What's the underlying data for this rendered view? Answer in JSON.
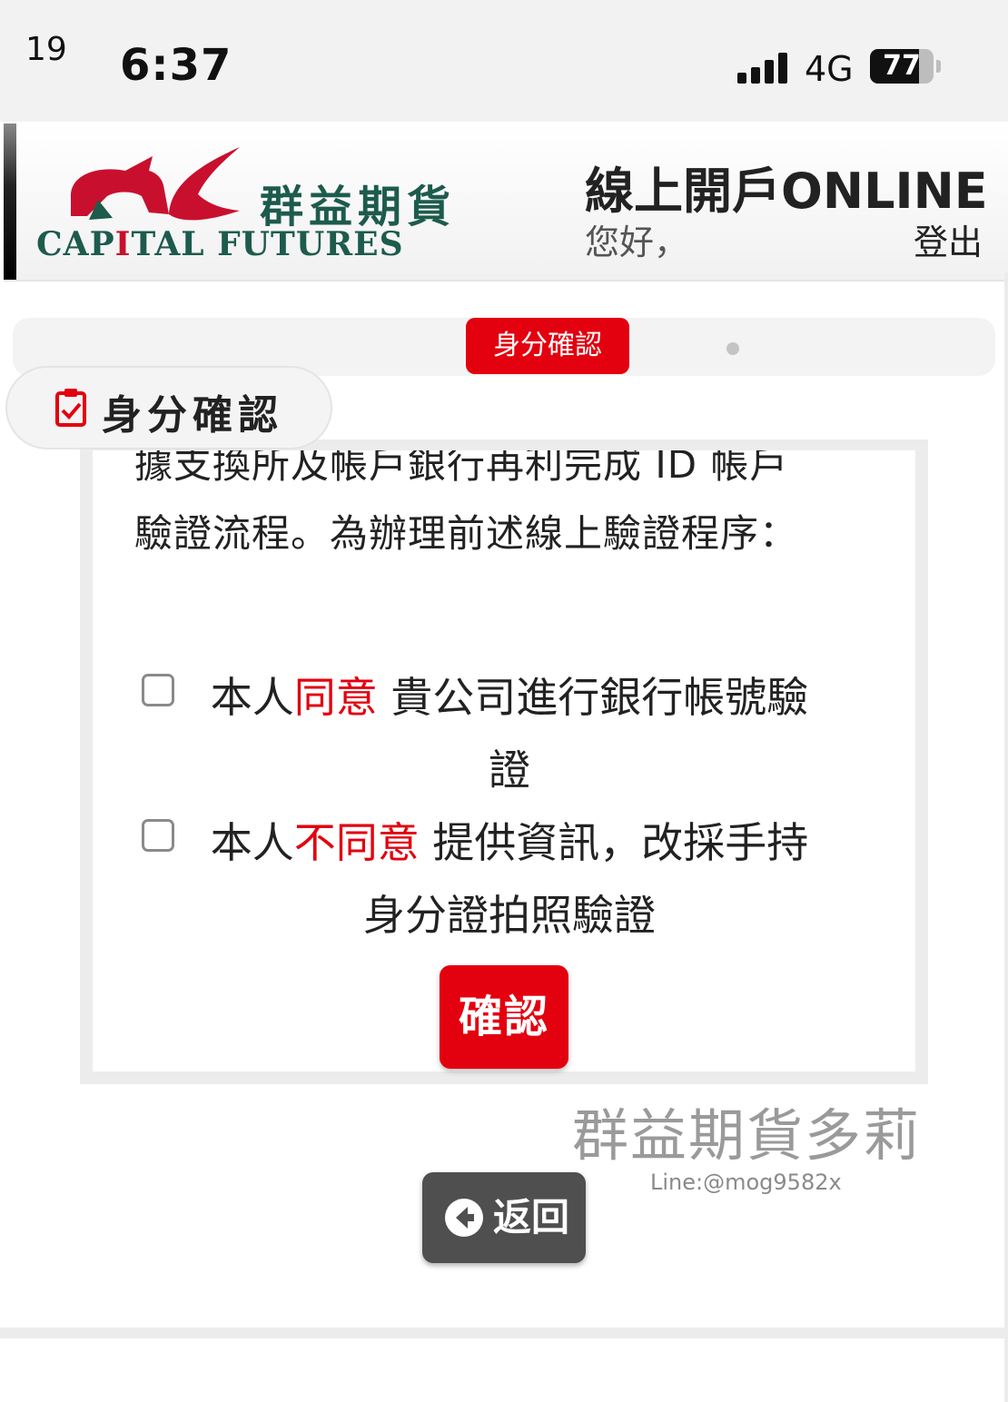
{
  "status_bar": {
    "left_number": "19",
    "time": "6:37",
    "network": "4G",
    "battery": "77",
    "battery_level_percent": 77
  },
  "header": {
    "logo_cn": "群益期貨",
    "logo_en_part1": "CAP",
    "logo_en_highlight": "I",
    "logo_en_part2": "TAL FUTURES",
    "title": "線上開戶ONLINE",
    "greeting": "您好，",
    "logout": "登出"
  },
  "steps": {
    "active_label": "身分確認"
  },
  "section": {
    "title": "身分確認",
    "icon": "clipboard-check-icon"
  },
  "content": {
    "paragraph_cut": "據支換所及帳戶銀行再利完成 ID 帳戶",
    "paragraph": "驗證流程。為辦理前述線上驗證程序："
  },
  "options": [
    {
      "prefix": "本人",
      "highlight": "同意",
      "suffix": " 貴公司進行銀行帳號驗證",
      "checked": false
    },
    {
      "prefix": "本人",
      "highlight": "不同意",
      "suffix": " 提供資訊，改採手持身分證拍照驗證",
      "checked": false
    }
  ],
  "confirm_button": "確認",
  "watermark": {
    "name": "群益期貨多莉",
    "line": "Line:@mog9582x"
  },
  "back_button": "返回",
  "colors": {
    "accent_red": "#e3000f",
    "brand_green": "#1d5b4d",
    "back_gray": "#4f4f4f"
  }
}
